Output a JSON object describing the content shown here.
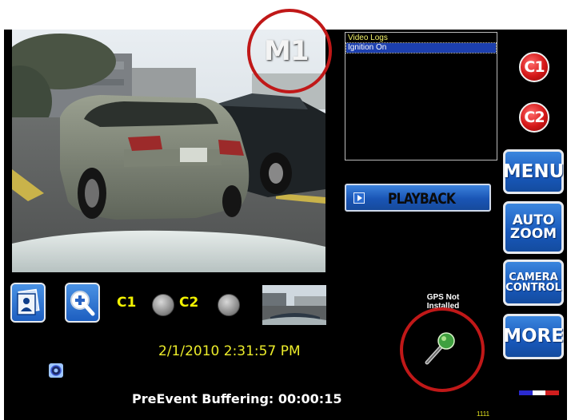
{
  "camera": {
    "overlay_label": "M1"
  },
  "logs": {
    "items": [
      "Video Logs",
      "Ignition On"
    ],
    "selected_index": 1
  },
  "playback": {
    "label": "PLAYBACK"
  },
  "side_buttons": {
    "c1": "C1",
    "c2": "C2",
    "menu": "MENU",
    "auto_zoom": [
      "AUTO",
      "ZOOM"
    ],
    "camera_control": [
      "CAMERA",
      "CONTROL"
    ],
    "more": "MORE"
  },
  "channels": {
    "c1_label": "C1",
    "c2_label": "C2"
  },
  "gps": {
    "status": "GPS Not Installed"
  },
  "datetime": "2/1/2010 2:31:57 PM",
  "buffer_status": "PreEvent Buffering: 00:00:15",
  "counter": "1111",
  "colors": {
    "accent": "#1d5ec0",
    "highlight_ring": "#c01818",
    "text_yellow": "#ecec2a"
  },
  "icons": [
    "photo-icon",
    "zoom-in-icon",
    "microphone-icon",
    "target-icon"
  ]
}
